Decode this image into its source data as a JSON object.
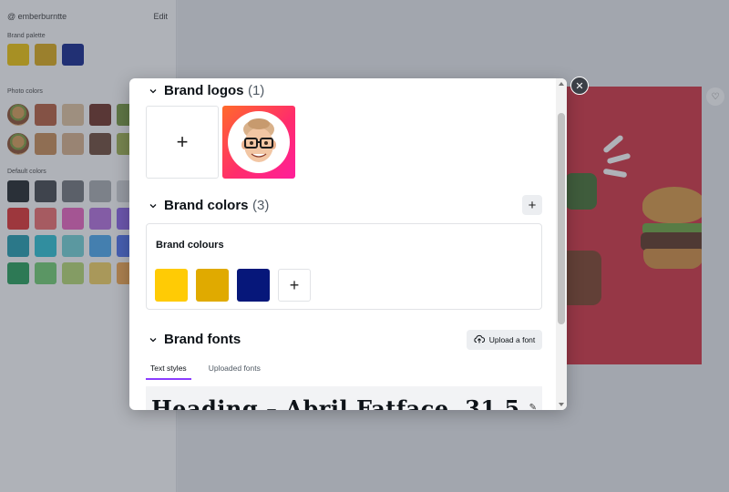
{
  "sidebar": {
    "handle": "@ emberburntte",
    "action": "Edit",
    "brand_palette_label": "Brand palette",
    "photo_colors_label": "Photo colors",
    "default_colors_label": "Default colors",
    "brand_palette": [
      "#f2c500",
      "#dcaa10",
      "#0b1f8a"
    ],
    "photo_row_2": [
      "#c98a52",
      "#d9b088",
      "#6c4633",
      "#9db04a"
    ],
    "photo_row_1": [
      "#b65a3a",
      "#e2c39d",
      "#6b2b1f",
      "#74973a"
    ],
    "default_rows": [
      [
        "#1b1f23",
        "#3f4347",
        "#6f7377",
        "#a7abaf",
        "#d0d3d6"
      ],
      [
        "#e02c2c",
        "#f06a6a",
        "#ec5fbf",
        "#b36bdf",
        "#8a5fe8"
      ],
      [
        "#1c9cae",
        "#26c2d4",
        "#6fd3d6",
        "#47a8f0",
        "#4b6ef0"
      ],
      [
        "#1f9d55",
        "#6fcf6f",
        "#b6d96f",
        "#f4d35e",
        "#f7a74b"
      ]
    ]
  },
  "modal": {
    "brand_logos": {
      "title": "Brand logos",
      "count": "(1)"
    },
    "brand_colors": {
      "title": "Brand colors",
      "count": "(3)"
    },
    "palette": {
      "name": "Brand colours",
      "swatches": [
        "#ffcb05",
        "#e0aa00",
        "#06177a"
      ]
    },
    "brand_fonts": {
      "title": "Brand fonts",
      "upload_label": "Upload a font"
    },
    "tabs": [
      {
        "label": "Text styles",
        "active": true
      },
      {
        "label": "Uploaded fonts",
        "active": false
      }
    ],
    "font_preview": "Heading – Abril Fatface, 31.5"
  },
  "icons": {
    "close": "close-icon",
    "plus": "plus-icon",
    "chevron": "chevron-down-icon",
    "upload": "cloud-upload-icon",
    "edit": "pencil-icon"
  },
  "colors": {
    "accent": "#8b3dff",
    "design_bg": "#d42c3c"
  }
}
